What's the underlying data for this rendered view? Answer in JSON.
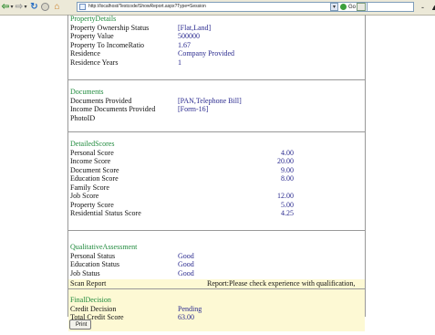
{
  "browser": {
    "url": "http://localhost/Testcode/ShowReport.aspx?Type=Session",
    "go_label": "Go",
    "minimize_label": "-"
  },
  "property": {
    "title": "PropertyDetails",
    "rows": [
      {
        "label": "Property Ownership Status",
        "value": "[Flat,Land]"
      },
      {
        "label": "Property Value",
        "value": "500000"
      },
      {
        "label": "Property To IncomeRatio",
        "value": "1.67"
      },
      {
        "label": "Residence",
        "value": "Company Provided"
      },
      {
        "label": "Residence Years",
        "value": "1"
      }
    ]
  },
  "documents": {
    "title": "Documents",
    "rows": [
      {
        "label": "Documents Provided",
        "value": "[PAN,Telephone Bill]"
      },
      {
        "label": "Income Documents Provided",
        "value": "[Form-16]"
      },
      {
        "label": "PhotoID",
        "value": ""
      }
    ]
  },
  "scores": {
    "title": "DetailedScores",
    "rows": [
      {
        "label": "Personal Score",
        "value": "4.00"
      },
      {
        "label": "Income Score",
        "value": "20.00"
      },
      {
        "label": "Document Score",
        "value": "9.00"
      },
      {
        "label": "Education Score",
        "value": "8.00"
      },
      {
        "label": "Family Score",
        "value": ""
      },
      {
        "label": "Job Score",
        "value": "12.00"
      },
      {
        "label": "Property Score",
        "value": "5.00"
      },
      {
        "label": "Residential Status Score",
        "value": "4.25"
      }
    ]
  },
  "qualitative": {
    "title": "QualitativeAssessment",
    "rows": [
      {
        "label": "Personal Status",
        "value": "Good"
      },
      {
        "label": "Education Status",
        "value": "Good"
      },
      {
        "label": "Job Status",
        "value": "Good"
      }
    ]
  },
  "scan": {
    "label": "Scan Report",
    "value": "Report:Please check experience with qualification,"
  },
  "final": {
    "title": "FinalDecision",
    "rows": [
      {
        "label": "Credit Decision",
        "value": "Pending"
      },
      {
        "label": "Total Credit Score",
        "value": "63.00"
      }
    ]
  },
  "print_label": "Print"
}
